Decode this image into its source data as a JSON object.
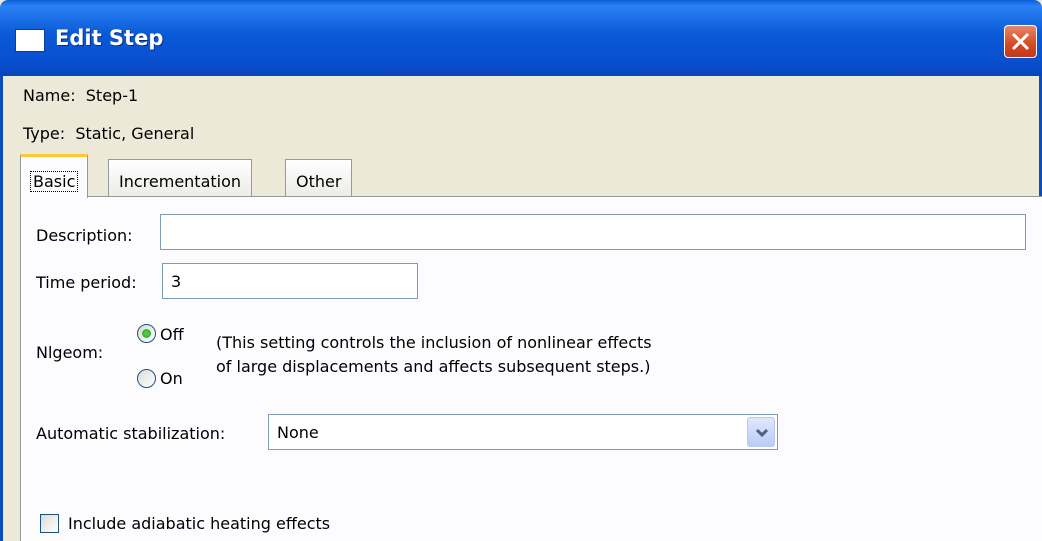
{
  "window": {
    "title": "Edit Step",
    "name_label": "Name:",
    "name_value": "Step-1",
    "type_label": "Type:",
    "type_value": "Static, General"
  },
  "tabs": [
    {
      "label": "Basic",
      "active": true
    },
    {
      "label": "Incrementation",
      "active": false
    },
    {
      "label": "Other",
      "active": false
    }
  ],
  "basic": {
    "description_label": "Description:",
    "description_value": "",
    "time_period_label": "Time period:",
    "time_period_value": "3",
    "nlgeom_label": "Nlgeom:",
    "nlgeom_options": [
      {
        "label": "Off",
        "selected": true
      },
      {
        "label": "On",
        "selected": false
      }
    ],
    "nlgeom_note_line1": "(This setting controls the inclusion of nonlinear effects",
    "nlgeom_note_line2": "of large displacements and affects subsequent steps.)",
    "stabilization_label": "Automatic stabilization:",
    "stabilization_value": "None",
    "adiabatic_label": "Include adiabatic heating effects",
    "adiabatic_checked": false
  },
  "colors": {
    "titlebar": "#0a59d6",
    "dialog_bg": "#ece9d8",
    "radio_selected": "#21a121",
    "close_button": "#d44a22"
  }
}
